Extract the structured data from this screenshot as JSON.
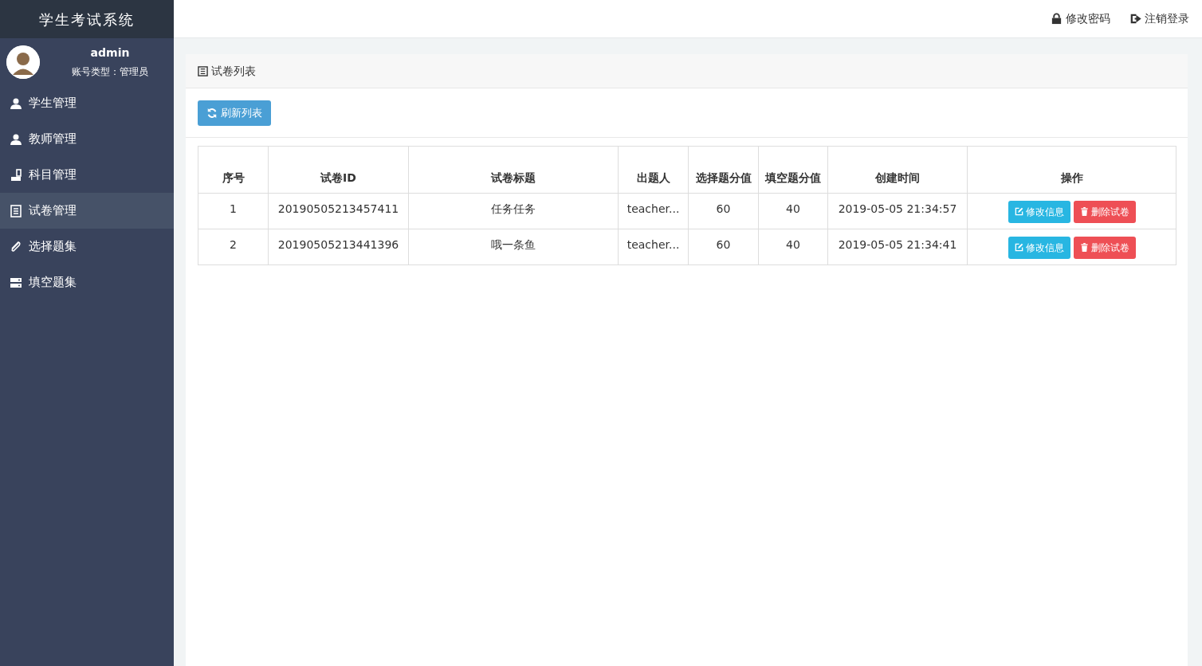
{
  "app_title": "学生考试系统",
  "user": {
    "name": "admin",
    "account_type": "账号类型：管理员"
  },
  "sidebar": {
    "items": [
      {
        "label": "学生管理",
        "selected": false
      },
      {
        "label": "教师管理",
        "selected": false
      },
      {
        "label": "科目管理",
        "selected": false
      },
      {
        "label": "试卷管理",
        "selected": true
      },
      {
        "label": "选择题集",
        "selected": false
      },
      {
        "label": "填空题集",
        "selected": false
      }
    ]
  },
  "header_links": [
    {
      "label": "修改密码"
    },
    {
      "label": "注销登录"
    }
  ],
  "panel": {
    "title": "试卷列表",
    "refresh_button": "刷新列表"
  },
  "table": {
    "columns": [
      "序号",
      "试卷ID",
      "试卷标题",
      "出题人",
      "选择题分值",
      "填空题分值",
      "创建时间",
      "操作"
    ],
    "rows": [
      {
        "cells": [
          "1",
          "20190505213457411",
          "任务任务",
          "teacher...",
          "60",
          "40",
          "2019-05-05 21:34:57"
        ],
        "actions": [
          {
            "label": "修改信息",
            "kind": "edit"
          },
          {
            "label": "删除试卷",
            "kind": "delete"
          }
        ]
      },
      {
        "cells": [
          "2",
          "20190505213441396",
          "哦一条鱼",
          "teacher...",
          "60",
          "40",
          "2019-05-05 21:34:41"
        ],
        "actions": [
          {
            "label": "修改信息",
            "kind": "edit"
          },
          {
            "label": "删除试卷",
            "kind": "delete"
          }
        ]
      }
    ]
  }
}
